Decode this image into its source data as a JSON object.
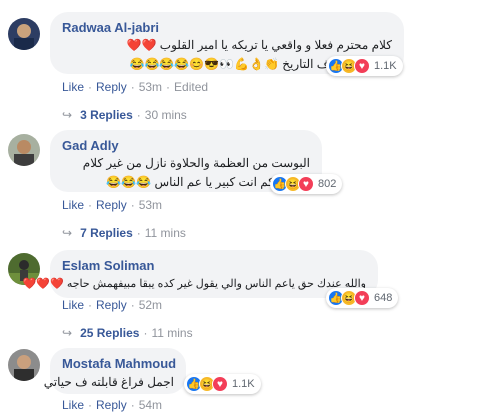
{
  "comments": [
    {
      "name": "Radwaa Al-jabri",
      "lines": [
        "كلام محترم فعلا و واقعي يا تريكه يا امير القلوب ❤️❤️",
        "احلي بوست ف التاريخ 👏👌💪👀😎😊😂😂😂😂"
      ],
      "reaction_count": "1.1K",
      "actions": {
        "like": "Like",
        "reply": "Reply",
        "time": "53m",
        "edited": "Edited"
      },
      "replies": {
        "label": "3 Replies",
        "time": "30 mins"
      }
    },
    {
      "name": "Gad Adly",
      "lines": [
        "البوست من العظمة والحلاوة نازل من غير كلام",
        "كم انت كبير يا عم الناس 😂😂😂"
      ],
      "reaction_count": "802",
      "actions": {
        "like": "Like",
        "reply": "Reply",
        "time": "53m"
      },
      "replies": {
        "label": "7 Replies",
        "time": "11 mins"
      }
    },
    {
      "name": "Eslam Soliman",
      "lines": [
        "والله عندك حق ياعم الناس والي يقول غير كده يبقا مبيفهمش حاجه ❤️❤️❤️"
      ],
      "reaction_count": "648",
      "actions": {
        "like": "Like",
        "reply": "Reply",
        "time": "52m"
      },
      "replies": {
        "label": "25 Replies",
        "time": "11 mins"
      }
    },
    {
      "name": "Mostafa Mahmoud",
      "lines": [
        "اجمل فراغ قابلته ف حياتي"
      ],
      "reaction_count": "1.1K",
      "actions": {
        "like": "Like",
        "reply": "Reply",
        "time": "54m"
      }
    }
  ],
  "separator": "·",
  "reaction_icons": [
    "like-reaction-icon",
    "haha-reaction-icon",
    "love-reaction-icon"
  ],
  "colors": {
    "link": "#385898",
    "meta": "#90949c",
    "bubble": "#f2f3f5",
    "like": "#1877f2",
    "haha": "#f7b928",
    "love": "#f33e58"
  }
}
